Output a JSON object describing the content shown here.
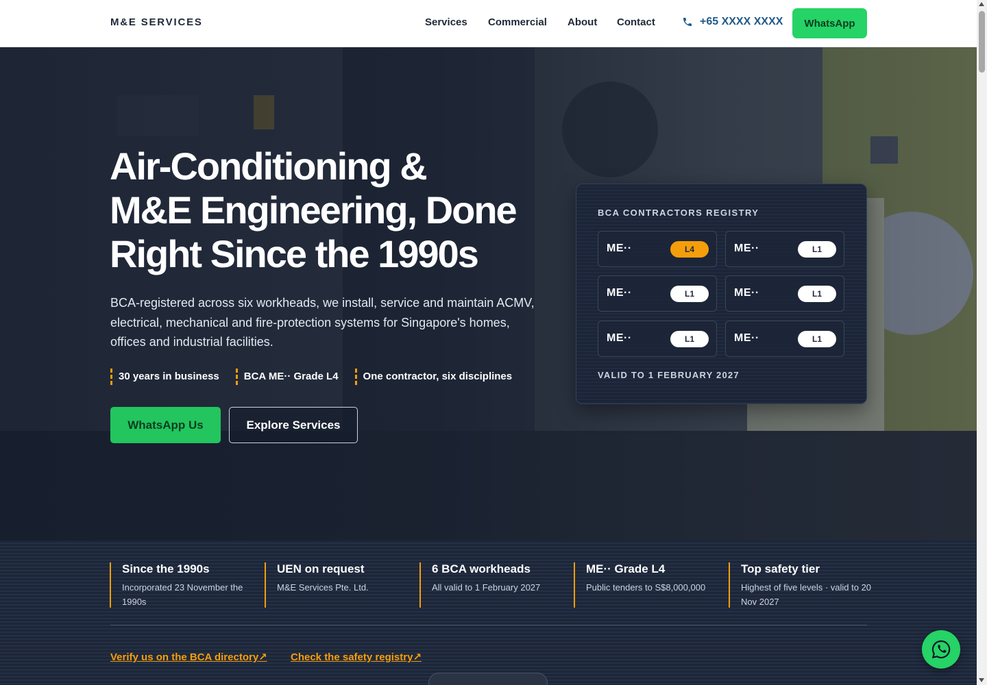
{
  "nav": {
    "brand": "M&E SERVICES",
    "links": [
      "Services",
      "Commercial",
      "About",
      "Contact"
    ],
    "phone": "+65 XXXX XXXX",
    "whatsapp_label": "WhatsApp"
  },
  "hero": {
    "headline": [
      "Air-Conditioning &",
      "M&E Engineering, Done",
      "Right Since the 1990s"
    ],
    "lead": "BCA-registered across six workheads, we install, service and maintain ACMV, electrical, mechanical and fire-protection systems for Singapore's homes, offices and industrial facilities.",
    "facts": [
      "30 years in business",
      "BCA ME·· Grade L4",
      "One contractor, six disciplines"
    ],
    "primary_button": "WhatsApp Us",
    "secondary_button": "Explore Services"
  },
  "registry": {
    "title": "BCA CONTRACTORS REGISTRY",
    "items": [
      {
        "code": "ME··",
        "grade": "L4",
        "highlight": true
      },
      {
        "code": "ME··",
        "grade": "L1",
        "highlight": false
      },
      {
        "code": "ME··",
        "grade": "L1",
        "highlight": false
      },
      {
        "code": "ME··",
        "grade": "L1",
        "highlight": false
      },
      {
        "code": "ME··",
        "grade": "L1",
        "highlight": false
      },
      {
        "code": "ME··",
        "grade": "L1",
        "highlight": false
      }
    ],
    "valid": "VALID TO 1 FEBRUARY 2027"
  },
  "stats": [
    {
      "title": "Since the 1990s",
      "sub": "Incorporated 23 November the 1990s"
    },
    {
      "title": "UEN on request",
      "sub": "M&E Services Pte. Ltd."
    },
    {
      "title": "6 BCA workheads",
      "sub": "All valid to 1 February 2027"
    },
    {
      "title": "ME·· Grade L4",
      "sub": "Public tenders to S$8,000,000"
    },
    {
      "title": "Top safety tier",
      "sub": "Highest of five levels · valid to 20 Nov 2027"
    }
  ],
  "links": {
    "bca": "Verify us on the BCA directory↗",
    "safety": "Check the safety registry↗"
  },
  "colors": {
    "accent": "#f59e0b",
    "whatsapp": "#25d366",
    "navy": "#1e2a3b"
  },
  "icons": {
    "phone": "phone-icon",
    "fab": "whatsapp-icon"
  }
}
